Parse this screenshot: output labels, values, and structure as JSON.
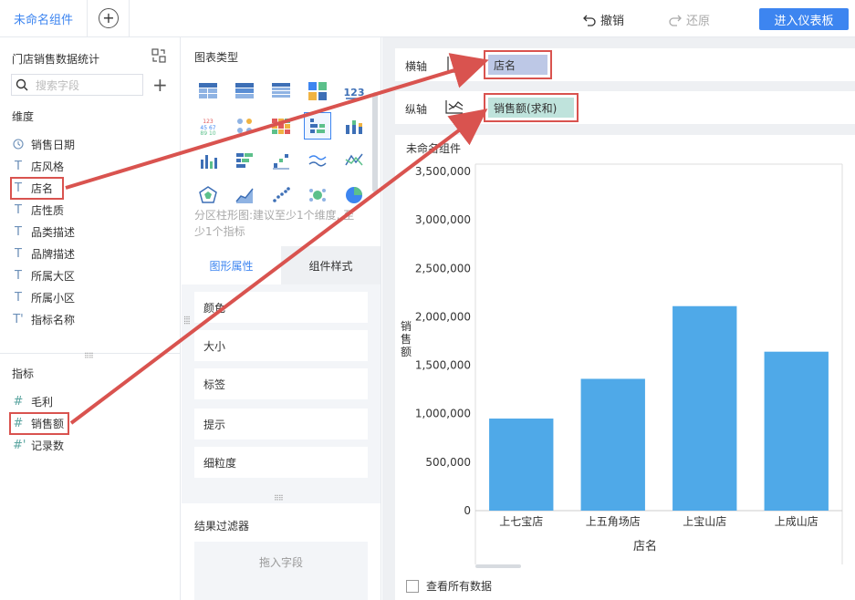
{
  "topbar": {
    "tab_label": "未命名组件",
    "add_tab": "+",
    "undo_label": "撤销",
    "redo_label": "还原",
    "enter_dashboard_label": "进入仪表板"
  },
  "fields_panel": {
    "dataset_name": "门店销售数据统计",
    "search_placeholder": "搜索字段",
    "dimension_section": "维度",
    "dimensions": [
      {
        "name": "销售日期",
        "icon": "clock-icon",
        "glyph": "🕓"
      },
      {
        "name": "店风格",
        "icon": "text-icon",
        "glyph": "T"
      },
      {
        "name": "店名",
        "icon": "text-icon",
        "glyph": "T"
      },
      {
        "name": "店性质",
        "icon": "text-icon",
        "glyph": "T"
      },
      {
        "name": "品类描述",
        "icon": "text-icon",
        "glyph": "T"
      },
      {
        "name": "品牌描述",
        "icon": "text-icon",
        "glyph": "T"
      },
      {
        "name": "所属大区",
        "icon": "text-icon",
        "glyph": "T"
      },
      {
        "name": "所属小区",
        "icon": "text-icon",
        "glyph": "T"
      },
      {
        "name": "指标名称",
        "icon": "text-calc-icon",
        "glyph": "T'"
      }
    ],
    "measure_section": "指标",
    "measures": [
      {
        "name": "毛利",
        "icon": "hash-icon",
        "glyph": "#"
      },
      {
        "name": "销售额",
        "icon": "hash-icon",
        "glyph": "#"
      },
      {
        "name": "记录数",
        "icon": "hash-calc-icon",
        "glyph": "#'"
      }
    ]
  },
  "chart_types_panel": {
    "title": "图表类型",
    "hint": "分区柱形图:建议至少1个维度, 至少1个指标",
    "tabs": [
      "图形属性",
      "组件样式"
    ],
    "attributes": [
      "颜色",
      "大小",
      "标签",
      "提示",
      "细粒度"
    ],
    "filter_title": "结果过滤器",
    "filter_placeholder": "拖入字段"
  },
  "axes": {
    "x_label": "横轴",
    "x_field": "店名",
    "y_label": "纵轴",
    "y_field": "销售额(求和)"
  },
  "widget": {
    "title": "未命名组件",
    "view_all_label": "查看所有数据"
  },
  "colors": {
    "accent": "#3d85f0",
    "bar": "#4fa9e8",
    "annotation": "#d9534f"
  },
  "chart_data": {
    "type": "bar",
    "categories": [
      "上七宝店",
      "上五角场店",
      "上宝山店",
      "上成山店"
    ],
    "series": [
      {
        "values": [
          950000,
          1360000,
          2110000,
          1640000
        ]
      }
    ],
    "xlabel": "店名",
    "ylabel": "销售额",
    "ylim": [
      0,
      3500000
    ],
    "yticks": [
      0,
      500000,
      1000000,
      1500000,
      2000000,
      2500000,
      3000000,
      3500000
    ],
    "ytick_labels": [
      "0",
      "500,000",
      "1,000,000",
      "1,500,000",
      "2,000,000",
      "2,500,000",
      "3,000,000",
      "3,500,000"
    ],
    "grid": false
  }
}
